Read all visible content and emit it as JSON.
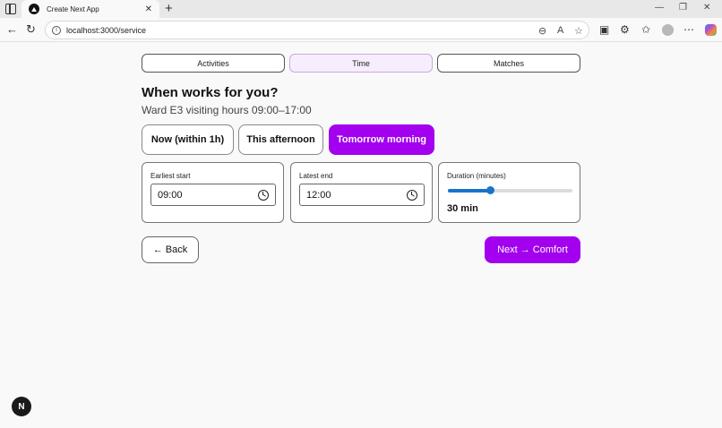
{
  "browser": {
    "tab_title": "Create Next App",
    "tab_close": "✕",
    "new_tab": "+",
    "url": "localhost:3000/service",
    "controls": {
      "minimize": "—",
      "maximize": "❐",
      "close": "✕"
    }
  },
  "steps": [
    {
      "label": "Activities",
      "active": false
    },
    {
      "label": "Time",
      "active": true
    },
    {
      "label": "Matches",
      "active": false
    }
  ],
  "heading": "When works for you?",
  "subheading": "Ward E3 visiting hours 09:00–17:00",
  "choices": [
    {
      "label": "Now (within 1h)",
      "selected": false
    },
    {
      "label": "This afternoon",
      "selected": false
    },
    {
      "label": "Tomorrow morning",
      "selected": true
    }
  ],
  "earliest": {
    "label": "Earliest start",
    "value": "09:00"
  },
  "latest": {
    "label": "Latest end",
    "value": "12:00"
  },
  "duration": {
    "label": "Duration (minutes)",
    "value_text": "30 min",
    "slider_fraction": 0.34
  },
  "nav": {
    "back": "← Back",
    "next": "Next → Comfort"
  },
  "colors": {
    "accent": "#a200ee",
    "slider": "#1a73c9"
  },
  "dev_badge": "N"
}
